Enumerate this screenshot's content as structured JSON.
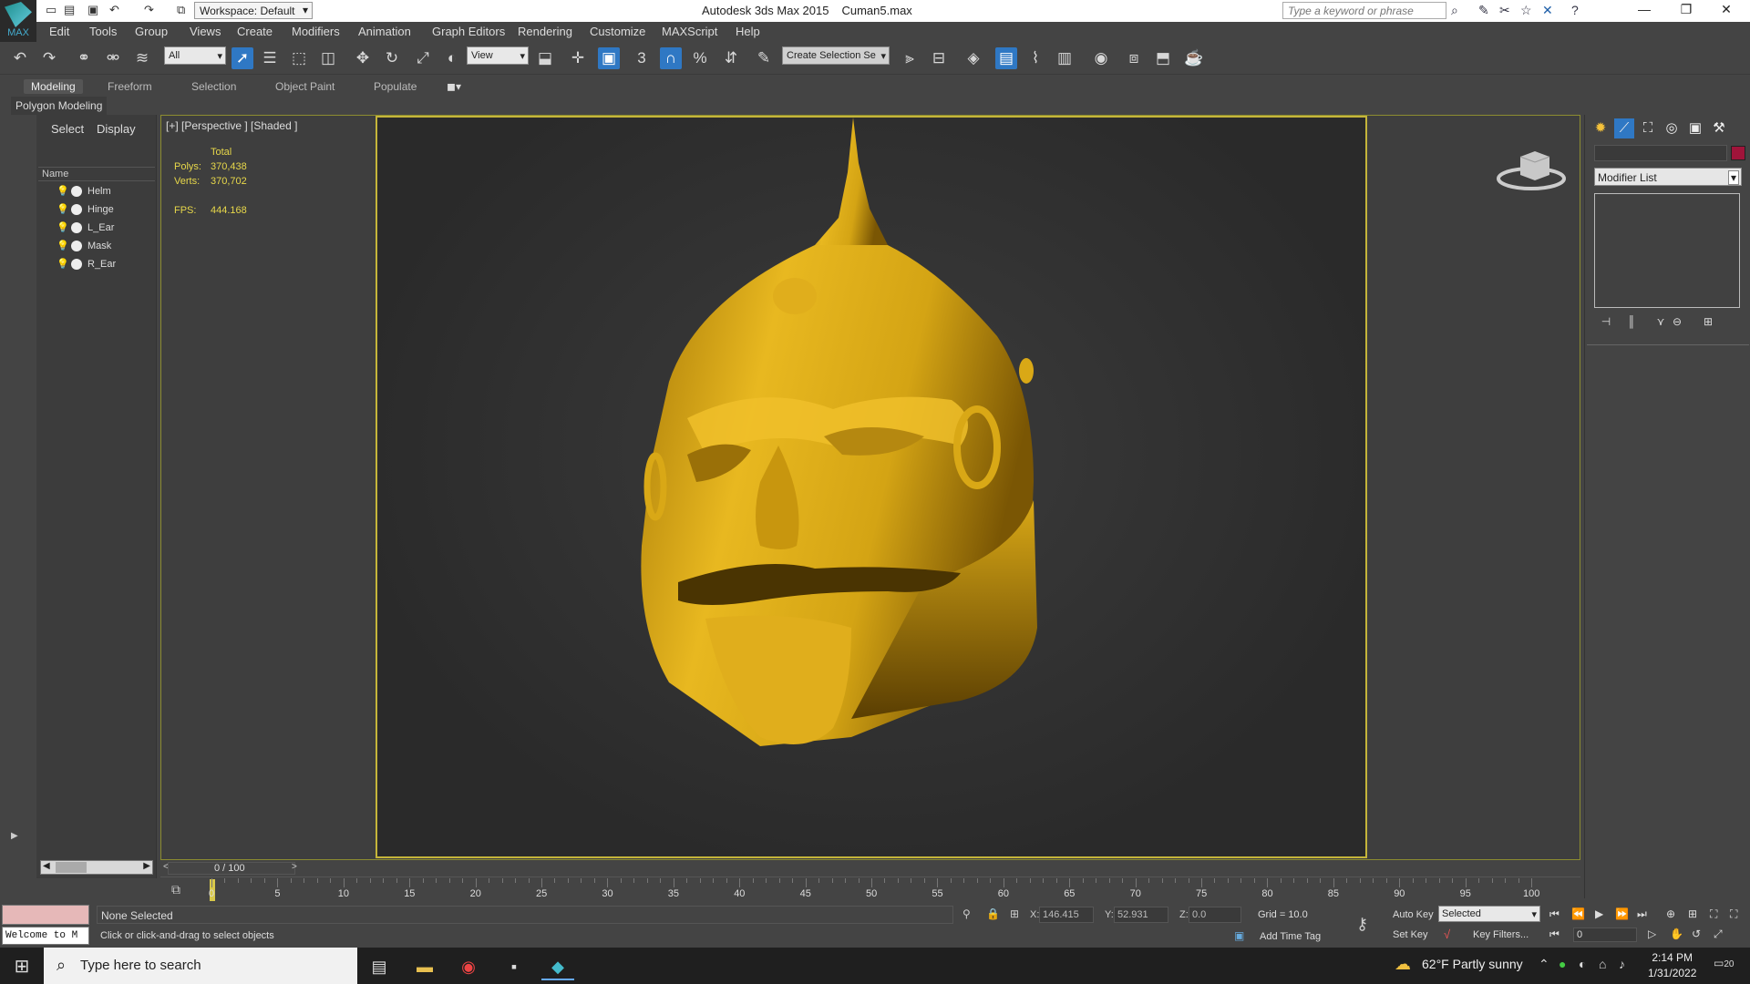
{
  "app": {
    "title": "Autodesk 3ds Max  2015",
    "file": "Cuman5.max",
    "workspace": "Workspace: Default",
    "search_placeholder": "Type a keyword or phrase",
    "logo_text": "MAX"
  },
  "menu": [
    "Edit",
    "Tools",
    "Group",
    "Views",
    "Create",
    "Modifiers",
    "Animation",
    "Graph Editors",
    "Rendering",
    "Customize",
    "MAXScript",
    "Help"
  ],
  "toolbar": {
    "filter": "All",
    "ref_coord": "View",
    "named_sel": "Create Selection Se",
    "snap_3": "3",
    "percent": "%"
  },
  "ribbon": {
    "tabs": [
      "Modeling",
      "Freeform",
      "Selection",
      "Object Paint",
      "Populate"
    ],
    "active_tab": "Modeling",
    "panel": "Polygon Modeling"
  },
  "scene_explorer": {
    "tabs": [
      "Select",
      "Display"
    ],
    "column": "Name",
    "objects": [
      "Helm",
      "Hinge",
      "L_Ear",
      "Mask",
      "R_Ear"
    ]
  },
  "viewport": {
    "label": "[+] [Perspective ] [Shaded ]",
    "stats": {
      "header": "Total",
      "polys_label": "Polys:",
      "polys": "370,438",
      "verts_label": "Verts:",
      "verts": "370,702",
      "fps_label": "FPS:",
      "fps": "444.168"
    },
    "model_color": "#d4a414",
    "frame_color": "#c5b53a"
  },
  "command_panel": {
    "modifier_list": "Modifier List",
    "object_color": "#a0143a"
  },
  "timeline": {
    "slider": "0 / 100",
    "ticks": [
      "0",
      "5",
      "10",
      "15",
      "20",
      "25",
      "30",
      "35",
      "40",
      "45",
      "50",
      "55",
      "60",
      "65",
      "70",
      "75",
      "80",
      "85",
      "90",
      "95",
      "100"
    ]
  },
  "status": {
    "maxscript": "Welcome to M",
    "selection": "None Selected",
    "prompt": "Click or click-and-drag to select objects",
    "x_label": "X:",
    "x": "146.415",
    "y_label": "Y:",
    "y": "52.931",
    "z_label": "Z:",
    "z": "0.0",
    "grid": "Grid = 10.0",
    "add_time_tag": "Add Time Tag",
    "auto_key": "Auto Key",
    "set_key": "Set Key",
    "selected_dd": "Selected",
    "key_filters": "Key Filters...",
    "frame": "0"
  },
  "taskbar": {
    "search": "Type here to search",
    "weather": "62°F  Partly sunny",
    "time": "2:14 PM",
    "date": "1/31/2022",
    "notif_count": "20"
  }
}
